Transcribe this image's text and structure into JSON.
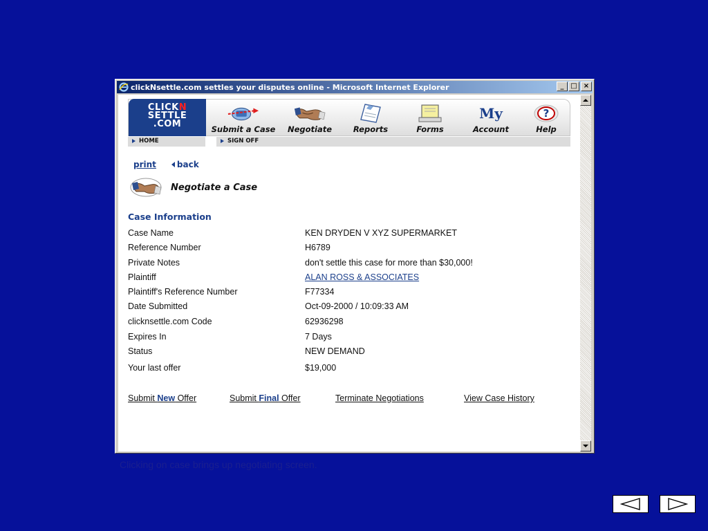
{
  "window": {
    "title": "clickNsettle.com settles your disputes online - Microsoft Internet Explorer",
    "controls": [
      "_",
      "□",
      "×"
    ]
  },
  "site": {
    "logo": {
      "line1_a": "CLICK",
      "line1_b": "N",
      "line2": "SETTLE",
      "line3": ".COM"
    },
    "nav": [
      {
        "label": "Submit a Case",
        "icon": "submit-case-icon"
      },
      {
        "label": "Negotiate",
        "icon": "handshake-icon"
      },
      {
        "label": "Reports",
        "icon": "reports-icon"
      },
      {
        "label": "Forms",
        "icon": "forms-icon"
      },
      {
        "label": "Account",
        "icon": "my-account-icon",
        "icon_text": "My"
      },
      {
        "label": "Help",
        "icon": "help-icon",
        "icon_text": "?"
      }
    ],
    "subnav": {
      "home": "HOME",
      "signoff": "SIGN OFF"
    },
    "links": {
      "print": "print",
      "back": "back"
    },
    "heading": "Negotiate a Case"
  },
  "case": {
    "section_title": "Case Information",
    "rows": [
      {
        "label": "Case Name",
        "value": "KEN DRYDEN V XYZ SUPERMARKET"
      },
      {
        "label": "Reference Number",
        "value": "H6789"
      },
      {
        "label": "Private Notes",
        "value": "don't settle this case for more than $30,000!"
      },
      {
        "label": "Plaintiff",
        "value": "ALAN ROSS & ASSOCIATES"
      },
      {
        "label": "Plaintiff's Reference Number",
        "value": "F77334"
      },
      {
        "label": "Date Submitted",
        "value": "Oct-09-2000 / 10:09:33 AM"
      },
      {
        "label": "clicknsettle.com Code",
        "value": "62936298"
      },
      {
        "label": "Expires In",
        "value": "7 Days"
      },
      {
        "label": "Status",
        "value": "NEW DEMAND"
      },
      {
        "label": "Your last offer",
        "value": "$19,000"
      }
    ]
  },
  "actions": {
    "submit_new": {
      "pre": "Submit ",
      "bold": "New",
      "post": " Offer"
    },
    "submit_final": {
      "pre": "Submit ",
      "bold": "Final",
      "post": " Offer"
    },
    "terminate": "Terminate Negotiations",
    "history": "View Case History"
  },
  "caption": "Clicking on case brings up negotiating screen.",
  "colors": {
    "slide_bg": "#06119a",
    "brand": "#1b3f8b",
    "caption": "#1a1f8f"
  }
}
